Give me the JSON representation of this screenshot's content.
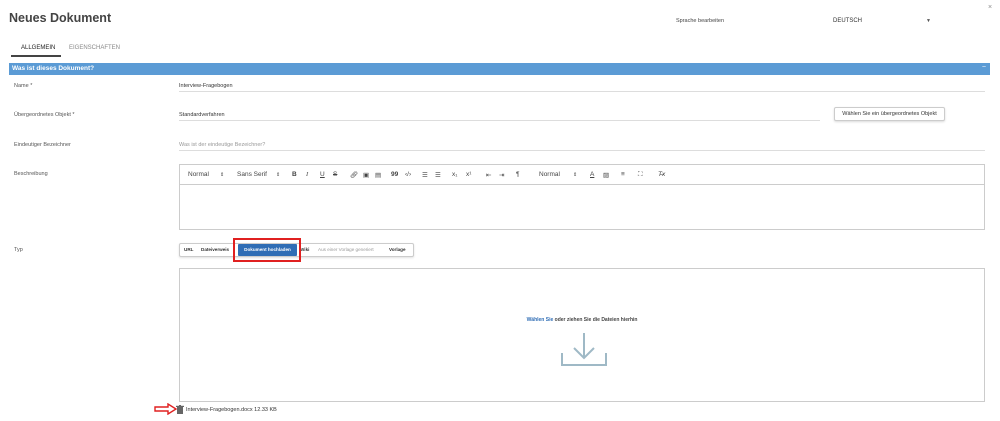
{
  "header": {
    "title": "Neues Dokument",
    "close_icon": "close-icon",
    "language_label": "Sprache bearbeiten",
    "language_value": "DEUTSCH"
  },
  "tabs": [
    {
      "label": "ALLGEMEIN",
      "active": true
    },
    {
      "label": "EIGENSCHAFTEN",
      "active": false
    }
  ],
  "section": {
    "title": "Was ist dieses Dokument?",
    "collapse_symbol": "−",
    "color": "#5b9bd5"
  },
  "form": {
    "name": {
      "label": "Name *",
      "value": "Interview-Fragebogen"
    },
    "parent": {
      "label": "Übergeordnetes Objekt *",
      "value": "Standardverfahren",
      "button": "Wählen Sie ein übergeordnetes Objekt"
    },
    "identifier": {
      "label": "Eindeutiger Bezeichner",
      "placeholder": "Was ist der eindeutige Bezeichner?"
    },
    "description": {
      "label": "Beschreibung",
      "toolbar": {
        "format": "Normal",
        "font": "Sans Serif",
        "bold": "B",
        "italic": "I",
        "underline": "U",
        "strike": "S",
        "blockquote": "99",
        "code": "‹/›",
        "sub": "x₁",
        "sup": "x¹",
        "size": "Normal",
        "color": "A",
        "clean": "T̶x"
      }
    },
    "type": {
      "label": "Typ",
      "options": [
        "URL",
        "Dateiverweis",
        "Dokument hochladen",
        "Wiki",
        "Aus einer Vorlage generiert",
        "Vorlage"
      ],
      "selected": "Dokument hochladen"
    },
    "upload": {
      "link": "Wählen Sie",
      "text": " oder ziehen Sie die Dateien hierhin",
      "icon": "download-icon"
    },
    "file": {
      "name": "Interview-Fragebogen.docx 12.33 KB",
      "icon": "trash-icon"
    }
  },
  "annotation_color": "#e02020",
  "accent_color": "#2f6db5"
}
